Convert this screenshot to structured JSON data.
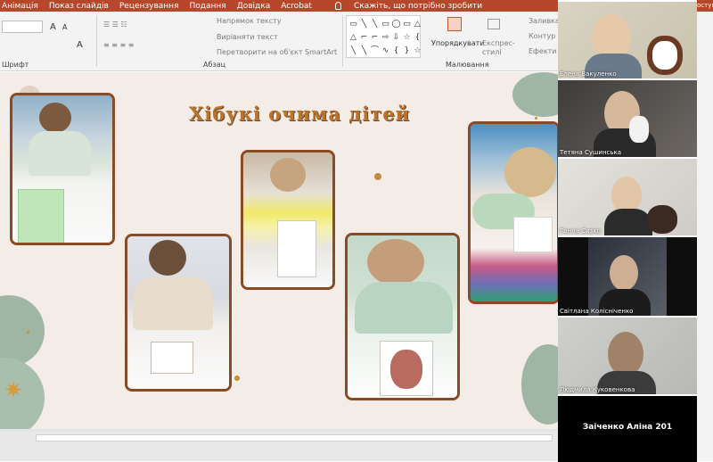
{
  "menu": {
    "tabs": [
      "Анімація",
      "Показ слайдів",
      "Рецензування",
      "Подання",
      "Довідка",
      "Acrobat"
    ],
    "tell_me": "Скажіть, що потрібно зробити",
    "right_cut": "оступ"
  },
  "ribbon": {
    "text_direction": "Напрямок тексту",
    "align_text": "Вирівняти текст",
    "smartart": "Перетворити на об'єкт SmartArt",
    "font_group": "Шрифт",
    "paragraph_group": "Абзац",
    "arrange": "Упорядкувати",
    "quick_styles": "Експрес-стилі",
    "drawing_group": "Малювання",
    "fill": "Заливка",
    "outline": "Контур ф",
    "effects": "Ефекти ф",
    "font_size_letters": [
      "A",
      "A",
      "A"
    ]
  },
  "slide": {
    "title": "Хібукі очима дітей"
  },
  "participants": [
    {
      "name": "Елена Вакуленко"
    },
    {
      "name": "Тетяна Сушинська"
    },
    {
      "name": "Ганна Сизко"
    },
    {
      "name": "Світлана Колісніченко"
    },
    {
      "name": "Людмила Куковенкова"
    }
  ],
  "active_speaker": "Заіченко Аліна 201",
  "colors": {
    "menubar": "#b7472a",
    "slide_bg": "#f4ece6",
    "photo_border": "#8a4a24",
    "title": "#b9742f"
  }
}
